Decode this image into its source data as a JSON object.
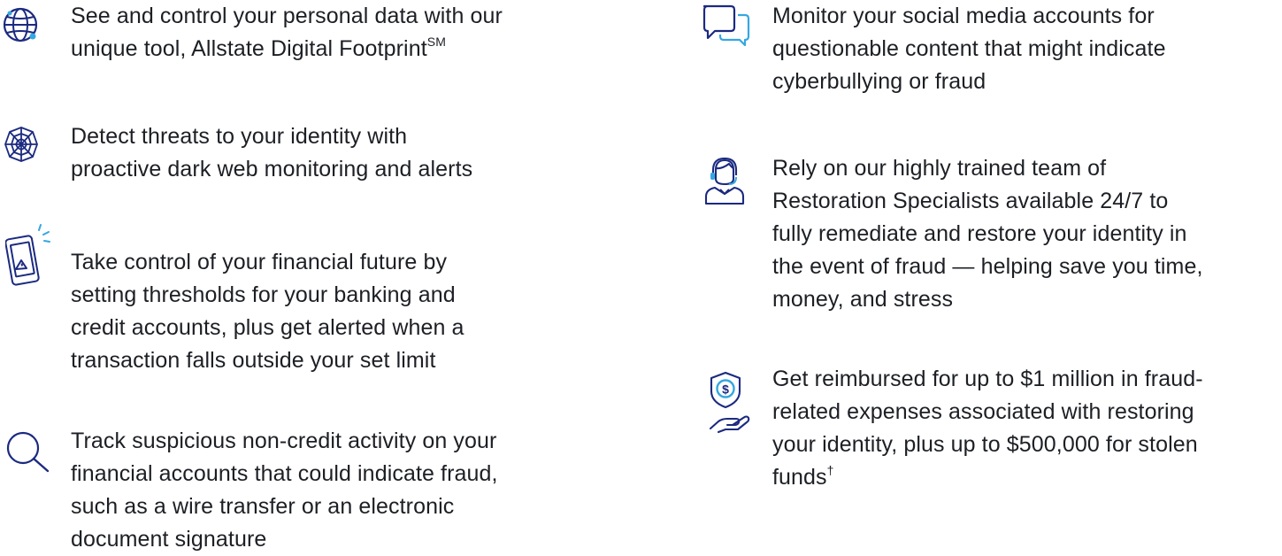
{
  "colors": {
    "icon_navy": "#1b2a80",
    "icon_accent": "#35a7e0",
    "text": "#1c1f24"
  },
  "left_column": [
    {
      "icon": "globe-icon",
      "lines": [
        "See and control your personal data with our",
        "unique tool, Allstate Digital Footprint"
      ],
      "superscript": "SM"
    },
    {
      "icon": "spider-web-icon",
      "lines": [
        "Detect threats to your identity with",
        "proactive dark web monitoring and alerts"
      ]
    },
    {
      "icon": "phone-alert-icon",
      "lines": [
        "Take control of your financial future by",
        "setting thresholds for your banking and",
        "credit accounts, plus get alerted when a",
        "transaction falls outside your set limit"
      ]
    },
    {
      "icon": "magnifier-icon",
      "lines": [
        "Track suspicious non-credit activity on your",
        "financial accounts that could indicate fraud,",
        "such as a wire transfer or an electronic",
        "document signature"
      ]
    }
  ],
  "right_column": [
    {
      "icon": "chat-bubbles-icon",
      "lines": [
        "Monitor your social media accounts for",
        "questionable content that might indicate",
        "cyberbullying or fraud"
      ]
    },
    {
      "icon": "support-agent-icon",
      "lines": [
        "Rely on our highly trained team of",
        "Restoration Specialists available 24/7 to",
        "fully remediate and restore your identity in",
        "the event of fraud — helping save you time,",
        "money, and stress"
      ]
    },
    {
      "icon": "shield-dollar-hand-icon",
      "lines": [
        "Get reimbursed for up to $1 million in fraud-",
        "related expenses associated with restoring",
        "your identity, plus up to $500,000 for stolen",
        "funds"
      ],
      "superscript": "†"
    }
  ]
}
